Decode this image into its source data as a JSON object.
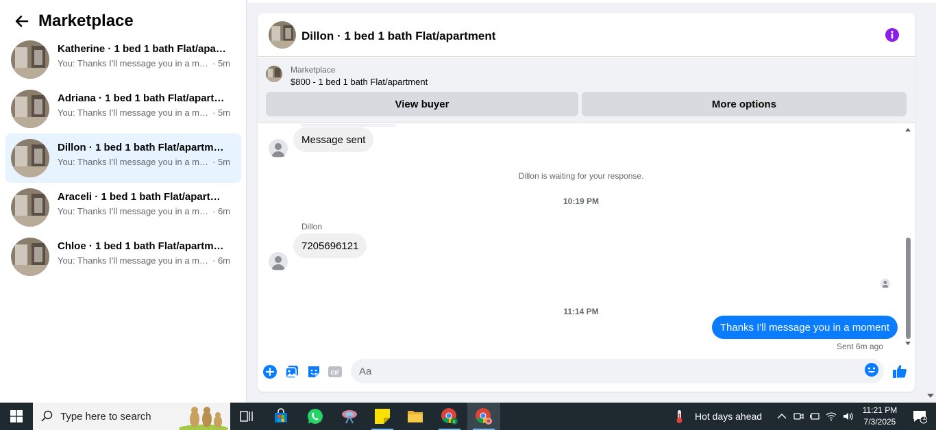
{
  "left": {
    "title": "Marketplace",
    "conversations": [
      {
        "title": "Katherine · 1 bed 1 bath Flat/apartment",
        "snippet": "You: Thanks I'll message you in a moment",
        "time": "· 5m",
        "active": false
      },
      {
        "title": "Adriana · 1 bed 1 bath Flat/apartment",
        "snippet": "You: Thanks I'll message you in a moment",
        "time": "· 5m",
        "active": false
      },
      {
        "title": "Dillon · 1 bed 1 bath Flat/apartment",
        "snippet": "You: Thanks I'll message you in a moment",
        "time": "· 5m",
        "active": true
      },
      {
        "title": "Araceli · 1 bed 1 bath Flat/apartment",
        "snippet": "You: Thanks I'll message you in a moment",
        "time": "· 6m",
        "active": false
      },
      {
        "title": "Chloe · 1 bed 1 bath Flat/apartment",
        "snippet": "You: Thanks I'll message you in a moment",
        "time": "· 6m",
        "active": false
      }
    ]
  },
  "chat": {
    "title": "Dillon · 1 bed 1 bath Flat/apartment",
    "listing": {
      "label": "Marketplace",
      "price": "$800 - 1 bed 1 bath Flat/apartment",
      "view_buyer": "View buyer",
      "more_options": "More options"
    },
    "messages": {
      "message_sent": "Message sent",
      "waiting": "Dillon is waiting for your response.",
      "time1": "10:19 PM",
      "sender": "Dillon",
      "phone": "7205696121",
      "time2": "11:14 PM",
      "outgoing": "Thanks I'll message you in a moment",
      "sent_status": "Sent 6m ago"
    },
    "composer": {
      "placeholder": "Aa"
    }
  },
  "taskbar": {
    "search_placeholder": "Type here to search",
    "weather": "Hot days ahead",
    "time": "11:21 PM",
    "date": "7/3/2025",
    "notif_count": "1"
  },
  "colors": {
    "accent": "#0a7cff",
    "info": "#8a1ee6",
    "active_row": "#e7f3ff"
  }
}
